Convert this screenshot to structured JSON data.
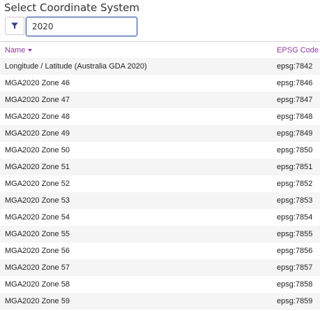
{
  "dialog": {
    "title": "Select Coordinate System"
  },
  "filter": {
    "icon": "filter-icon",
    "search_value": "2020"
  },
  "table": {
    "columns": {
      "name": "Name",
      "code": "EPSG Code"
    },
    "sort": {
      "column": "name",
      "direction": "descending-indicator"
    },
    "rows": [
      {
        "name": "Longitude / Latitude (Australia GDA 2020)",
        "code": "epsg:7842"
      },
      {
        "name": "MGA2020 Zone 46",
        "code": "epsg:7846"
      },
      {
        "name": "MGA2020 Zone 47",
        "code": "epsg:7847"
      },
      {
        "name": "MGA2020 Zone 48",
        "code": "epsg:7848"
      },
      {
        "name": "MGA2020 Zone 49",
        "code": "epsg:7849"
      },
      {
        "name": "MGA2020 Zone 50",
        "code": "epsg:7850"
      },
      {
        "name": "MGA2020 Zone 51",
        "code": "epsg:7851"
      },
      {
        "name": "MGA2020 Zone 52",
        "code": "epsg:7852"
      },
      {
        "name": "MGA2020 Zone 53",
        "code": "epsg:7853"
      },
      {
        "name": "MGA2020 Zone 54",
        "code": "epsg:7854"
      },
      {
        "name": "MGA2020 Zone 55",
        "code": "epsg:7855"
      },
      {
        "name": "MGA2020 Zone 56",
        "code": "epsg:7856"
      },
      {
        "name": "MGA2020 Zone 57",
        "code": "epsg:7857"
      },
      {
        "name": "MGA2020 Zone 58",
        "code": "epsg:7858"
      },
      {
        "name": "MGA2020 Zone 59",
        "code": "epsg:7859"
      }
    ]
  },
  "colors": {
    "accent": "#8e3aa0",
    "input_border": "#2f4f9e",
    "filter_icon": "#2f3f8f",
    "row_alt": "#f5f5f5"
  }
}
